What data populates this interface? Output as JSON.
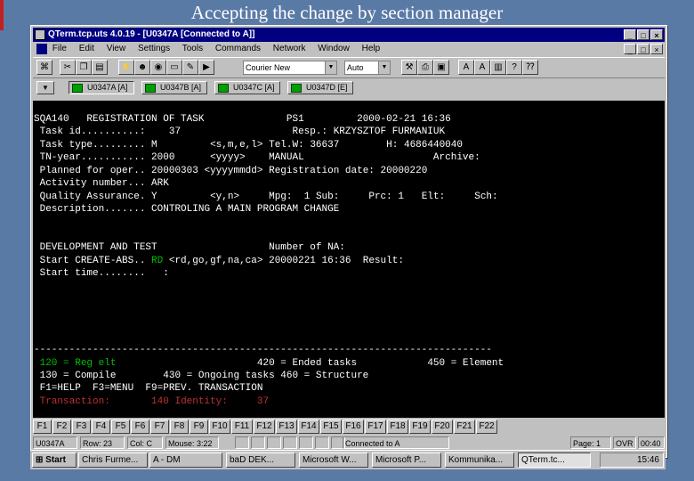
{
  "slide": {
    "title": "Accepting the change by section manager"
  },
  "window": {
    "title": "QTerm.tcp.uts 4.0.19 - [U0347A [Connected to A]]",
    "controls": [
      "_",
      "□",
      "×"
    ]
  },
  "menu": {
    "items": [
      "File",
      "Edit",
      "View",
      "Settings",
      "Tools",
      "Commands",
      "Network",
      "Window",
      "Help"
    ],
    "right_controls": [
      "_",
      "□",
      "×"
    ]
  },
  "toolbar": {
    "font_select": "Courier New",
    "size_select": "Auto"
  },
  "sessions": [
    {
      "label": "U0347A [A]",
      "active": true
    },
    {
      "label": "U0347B [A]",
      "active": false
    },
    {
      "label": "U0347C [A]",
      "active": false
    },
    {
      "label": "U0347D [E]",
      "active": false
    }
  ],
  "terminal": {
    "header": {
      "code": "SQA140",
      "title": "REGISTRATION OF TASK",
      "screen": "PS1",
      "datetime": "2000-02-21 16:36"
    },
    "task_id": {
      "label": "Task id..........:",
      "value": "37",
      "resp_label": "Resp.:",
      "resp_value": "KRZYSZTOF FURMANIUK"
    },
    "task_type": {
      "label": "Task type.........",
      "value": "M",
      "hint": "<s,m,e,l>",
      "tel_label": "Tel.W:",
      "tel_value": "36637",
      "h_label": "H:",
      "h_value": "4686440040"
    },
    "tn_year": {
      "label": "TN-year...........",
      "value": "2000",
      "hint": "<yyyy>",
      "manual": "MANUAL",
      "archive": "Archive:"
    },
    "planned": {
      "label": "Planned for oper..",
      "value": "20000303",
      "hint": "<yyyymmdd>",
      "reg_label": "Registration date:",
      "reg_value": "20000220"
    },
    "activity": {
      "label": "Activity number...",
      "value": "ARK"
    },
    "quality": {
      "label": "Quality Assurance.",
      "value": "Y",
      "hint": "<y,n>",
      "mpg_label": "Mpg:",
      "mpg_value": "1",
      "sub_label": "Sub:",
      "prc_label": "Prc:",
      "prc_value": "1",
      "elt_label": "Elt:",
      "sch_label": "Sch:"
    },
    "description": {
      "label": "Description.......",
      "value": "CONTROLING A MAIN PROGRAM CHANGE"
    },
    "dev_test": {
      "title": "DEVELOPMENT AND TEST",
      "na_label": "Number of NA:"
    },
    "start_create": {
      "label": "Start CREATE-ABS..",
      "value": "RD",
      "hint": "<rd,go,gf,na,ca>",
      "datetime": "20000221 16:36",
      "result_label": "Result:"
    },
    "start_time": {
      "label": "Start time........",
      "value": ":"
    },
    "divider": "------------------------------------------------------------------------------",
    "legend1": {
      "a": "120 = Reg elt",
      "b": "420 = Ended tasks",
      "c": "450 = Element"
    },
    "legend2": {
      "a": "130 = Compile",
      "b": "430 = Ongoing tasks 460 = Structure"
    },
    "legend3": "F1=HELP  F3=MENU  F9=PREV. TRANSACTION",
    "transaction": {
      "label": "Transaction:",
      "value": "140",
      "identity_label": "Identity:",
      "identity_value": "37"
    }
  },
  "function_keys": [
    "F1",
    "F2",
    "F3",
    "F4",
    "F5",
    "F6",
    "F7",
    "F8",
    "F9",
    "F10",
    "F11",
    "F12",
    "F13",
    "F14",
    "F15",
    "F16",
    "F17",
    "F18",
    "F19",
    "F20",
    "F21",
    "F22"
  ],
  "statusbar": {
    "session": "U0347A",
    "row": "Row: 23",
    "col": "Col: C",
    "mouse": "Mouse: 3:22",
    "connected": "Connected to A",
    "page": "Page: 1",
    "ovr": "OVR",
    "time": "00:40"
  },
  "taskbar": {
    "start": "Start",
    "items": [
      "Chris Furme...",
      "A - DM",
      "baD DEK...",
      "Microsoft W...",
      "Microsoft P...",
      "Kommunika...",
      "QTerm.tc..."
    ],
    "clock": "15:46"
  },
  "colors": {
    "terminal_bg": "#000000",
    "terminal_fg": "#ffffff",
    "highlight_red": "#c03030",
    "highlight_green": "#00c000",
    "titlebar": "#000080"
  }
}
